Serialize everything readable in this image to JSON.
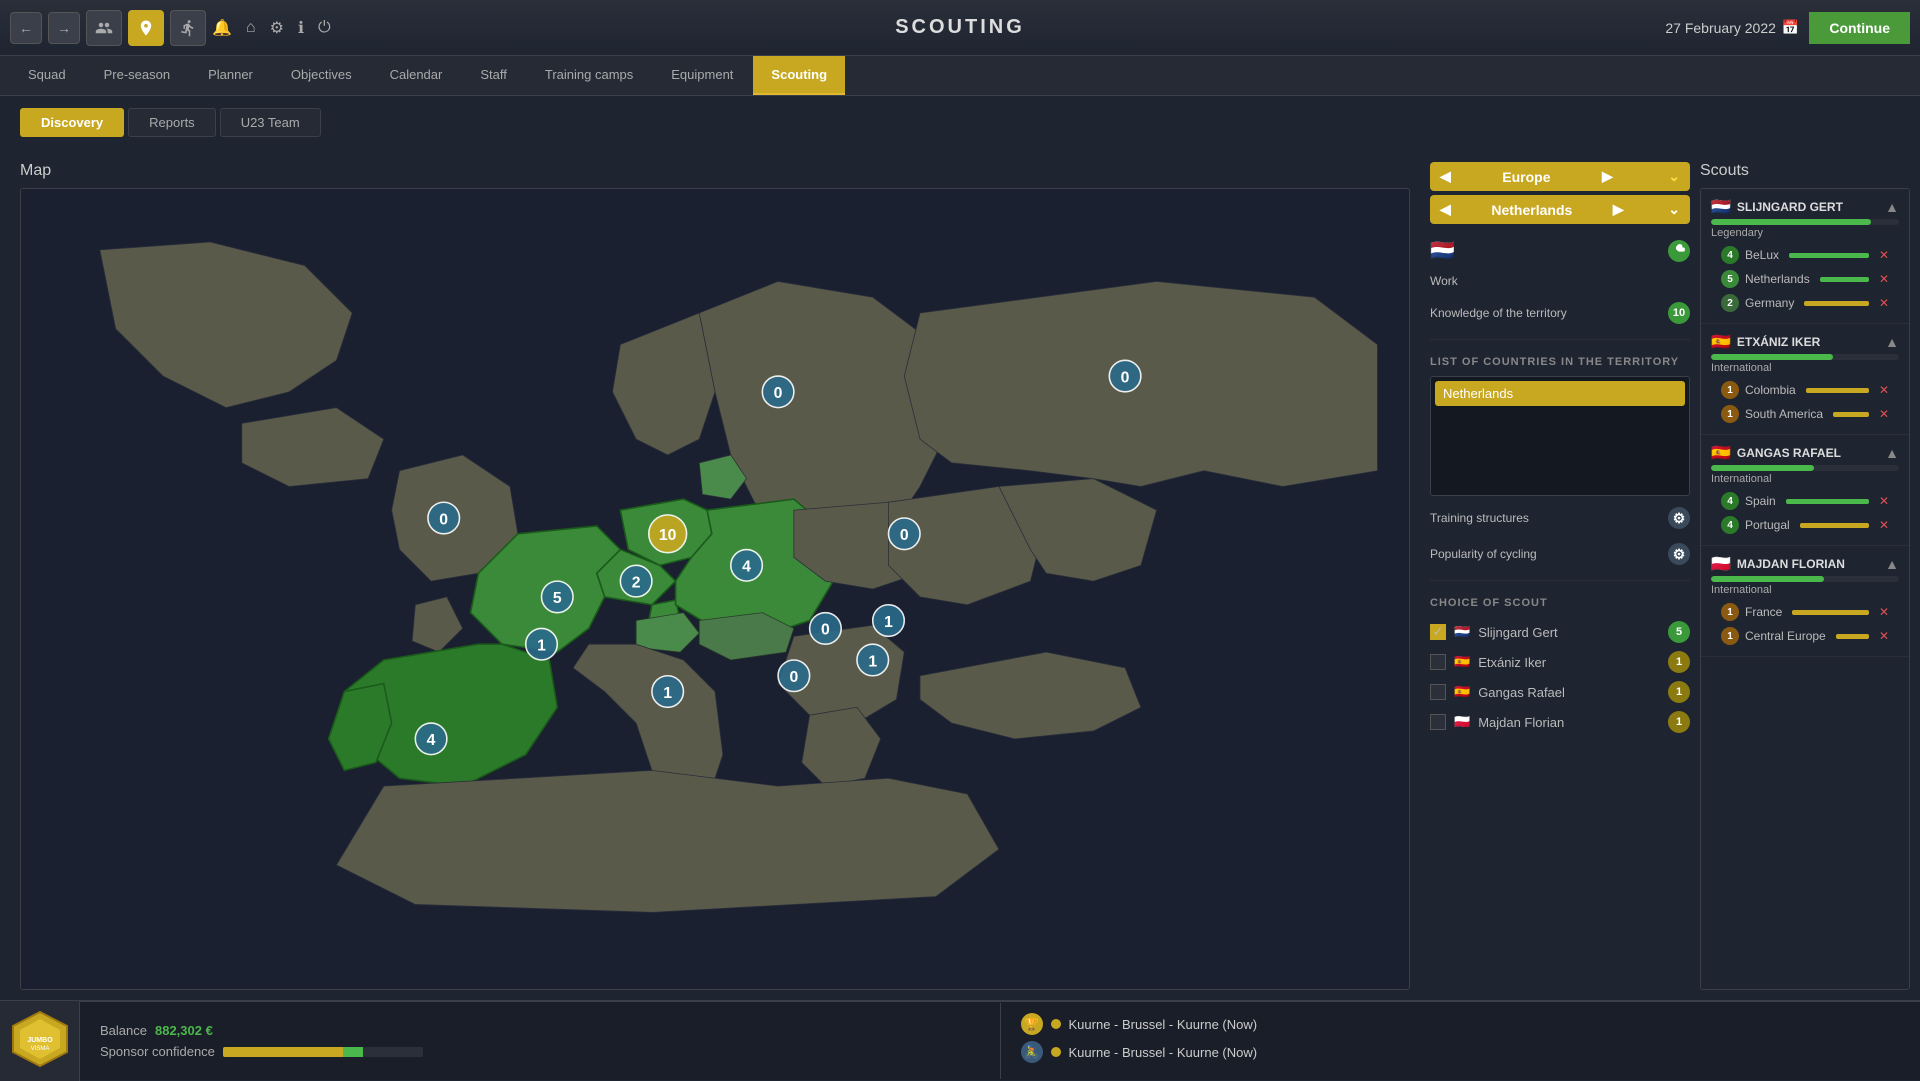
{
  "topbar": {
    "title": "SCOUTING",
    "date": "27 February 2022",
    "continue_label": "Continue"
  },
  "nav_tabs": [
    {
      "id": "squad",
      "label": "Squad"
    },
    {
      "id": "preseason",
      "label": "Pre-season"
    },
    {
      "id": "planner",
      "label": "Planner"
    },
    {
      "id": "objectives",
      "label": "Objectives"
    },
    {
      "id": "calendar",
      "label": "Calendar"
    },
    {
      "id": "staff",
      "label": "Staff"
    },
    {
      "id": "training_camps",
      "label": "Training camps"
    },
    {
      "id": "equipment",
      "label": "Equipment"
    },
    {
      "id": "scouting",
      "label": "Scouting",
      "active": true
    }
  ],
  "sub_tabs": [
    {
      "id": "discovery",
      "label": "Discovery",
      "active": true
    },
    {
      "id": "reports",
      "label": "Reports"
    },
    {
      "id": "u23team",
      "label": "U23 Team"
    }
  ],
  "map": {
    "title": "Map"
  },
  "region_selector": {
    "region": "Europe",
    "country": "Netherlands"
  },
  "info": {
    "work_label": "Work",
    "territory_label": "Knowledge of the territory",
    "territory_value": "10",
    "countries_section": "LIST OF COUNTRIES IN THE TERRITORY",
    "countries": [
      "Netherlands"
    ],
    "training_structures": "Training structures",
    "popularity": "Popularity of cycling",
    "choice_of_scout": "CHOICE OF SCOUT"
  },
  "scouts_choice": [
    {
      "name": "Slijngard Gert",
      "flag": "🇳🇱",
      "score": 5,
      "checked": true
    },
    {
      "name": "Etxániz Iker",
      "flag": "🇪🇸",
      "score": 1,
      "checked": false
    },
    {
      "name": "Gangas Rafael",
      "flag": "🇪🇸",
      "score": 1,
      "checked": false
    },
    {
      "name": "Majdan Florian",
      "flag": "🇵🇱",
      "score": 1,
      "checked": false
    }
  ],
  "scouts": {
    "title": "Scouts",
    "list": [
      {
        "name": "SLIJNGARD GERT",
        "flag": "🇳🇱",
        "rank": "Legendary",
        "bar_pct": 85,
        "expand": true,
        "regions": [
          {
            "name": "BeLux",
            "badge": 4,
            "bar": "full"
          },
          {
            "name": "Netherlands",
            "badge": 5,
            "bar": "full"
          },
          {
            "name": "Germany",
            "badge": 2,
            "bar": "partial"
          }
        ]
      },
      {
        "name": "ETXÁNIZ IKER",
        "flag": "🇪🇸",
        "rank": "International",
        "bar_pct": 65,
        "expand": true,
        "regions": [
          {
            "name": "Colombia",
            "badge": 1,
            "bar": "partial"
          },
          {
            "name": "South America",
            "badge": 1,
            "bar": "partial"
          }
        ]
      },
      {
        "name": "GANGAS RAFAEL",
        "flag": "🇪🇸",
        "rank": "International",
        "bar_pct": 55,
        "expand": true,
        "regions": [
          {
            "name": "Spain",
            "badge": 4,
            "bar": "full"
          },
          {
            "name": "Portugal",
            "badge": 4,
            "bar": "partial"
          }
        ]
      },
      {
        "name": "MAJDAN FLORIAN",
        "flag": "🇵🇱",
        "rank": "International",
        "bar_pct": 60,
        "expand": true,
        "regions": [
          {
            "name": "France",
            "badge": 1,
            "bar": "partial"
          },
          {
            "name": "Central Europe",
            "badge": 1,
            "bar": "partial"
          }
        ]
      }
    ]
  },
  "bottom": {
    "balance_label": "Balance",
    "balance_value": "882,302 €",
    "confidence_label": "Sponsor confidence",
    "events": [
      {
        "icon": "trophy",
        "text": "Kuurne - Brussel - Kuurne (Now)"
      },
      {
        "icon": "route",
        "text": "Kuurne - Brussel - Kuurne (Now)"
      }
    ]
  }
}
